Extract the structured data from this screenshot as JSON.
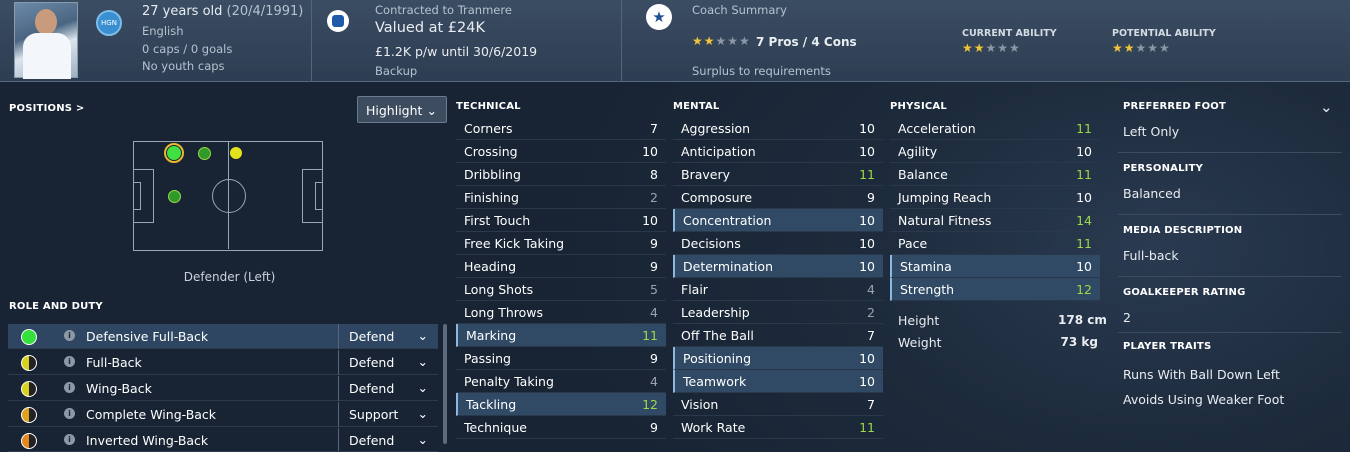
{
  "header": {
    "age": "27 years old",
    "dob": "(20/4/1991)",
    "nation_badge": "HGN",
    "nationality": "English",
    "caps": "0 caps / 0 goals",
    "youth_caps": "No youth caps",
    "contract_label": "Contracted to Tranmere",
    "value": "Valued at £24K",
    "wage": "£1.2K p/w until 30/6/2019",
    "squad_status": "Backup",
    "coach_label": "Coach Summary",
    "coach_rating": 2,
    "pros_cons": "7 Pros / 4 Cons",
    "coach_verdict": "Surplus to requirements",
    "current_ability_label": "CURRENT ABILITY",
    "current_ability": 2,
    "potential_ability_label": "POTENTIAL ABILITY",
    "potential_ability": 2
  },
  "positions": {
    "label": "POSITIONS >",
    "highlight": "Highlight",
    "position_text": "Defender (Left)"
  },
  "roles": {
    "label": "ROLE AND DUTY",
    "items": [
      {
        "name": "Defensive Full-Back",
        "duty": "Defend",
        "color": "#35e03c"
      },
      {
        "name": "Full-Back",
        "duty": "Defend",
        "color": "#d8d21e"
      },
      {
        "name": "Wing-Back",
        "duty": "Defend",
        "color": "#d8d21e"
      },
      {
        "name": "Complete Wing-Back",
        "duty": "Support",
        "color": "#e0a020"
      },
      {
        "name": "Inverted Wing-Back",
        "duty": "Defend",
        "color": "#e08a20"
      }
    ]
  },
  "technical": {
    "label": "TECHNICAL",
    "items": [
      {
        "name": "Corners",
        "value": "7"
      },
      {
        "name": "Crossing",
        "value": "10"
      },
      {
        "name": "Dribbling",
        "value": "8"
      },
      {
        "name": "Finishing",
        "value": "2"
      },
      {
        "name": "First Touch",
        "value": "10"
      },
      {
        "name": "Free Kick Taking",
        "value": "9"
      },
      {
        "name": "Heading",
        "value": "9"
      },
      {
        "name": "Long Shots",
        "value": "5"
      },
      {
        "name": "Long Throws",
        "value": "4"
      },
      {
        "name": "Marking",
        "value": "11"
      },
      {
        "name": "Passing",
        "value": "9"
      },
      {
        "name": "Penalty Taking",
        "value": "4"
      },
      {
        "name": "Tackling",
        "value": "12"
      },
      {
        "name": "Technique",
        "value": "9"
      }
    ]
  },
  "mental": {
    "label": "MENTAL",
    "items": [
      {
        "name": "Aggression",
        "value": "10"
      },
      {
        "name": "Anticipation",
        "value": "10"
      },
      {
        "name": "Bravery",
        "value": "11"
      },
      {
        "name": "Composure",
        "value": "9"
      },
      {
        "name": "Concentration",
        "value": "10"
      },
      {
        "name": "Decisions",
        "value": "10"
      },
      {
        "name": "Determination",
        "value": "10"
      },
      {
        "name": "Flair",
        "value": "4"
      },
      {
        "name": "Leadership",
        "value": "2"
      },
      {
        "name": "Off The Ball",
        "value": "7"
      },
      {
        "name": "Positioning",
        "value": "10"
      },
      {
        "name": "Teamwork",
        "value": "10"
      },
      {
        "name": "Vision",
        "value": "7"
      },
      {
        "name": "Work Rate",
        "value": "11"
      }
    ]
  },
  "physical": {
    "label": "PHYSICAL",
    "items": [
      {
        "name": "Acceleration",
        "value": "11"
      },
      {
        "name": "Agility",
        "value": "10"
      },
      {
        "name": "Balance",
        "value": "11"
      },
      {
        "name": "Jumping Reach",
        "value": "10"
      },
      {
        "name": "Natural Fitness",
        "value": "14"
      },
      {
        "name": "Pace",
        "value": "11"
      },
      {
        "name": "Stamina",
        "value": "10"
      },
      {
        "name": "Strength",
        "value": "12"
      }
    ],
    "height_label": "Height",
    "height": "178 cm",
    "weight_label": "Weight",
    "weight": "73 kg"
  },
  "info": {
    "foot_label": "PREFERRED FOOT",
    "foot": "Left Only",
    "personality_label": "PERSONALITY",
    "personality": "Balanced",
    "media_label": "MEDIA DESCRIPTION",
    "media": "Full-back",
    "gk_label": "GOALKEEPER RATING",
    "gk": "2",
    "traits_label": "PLAYER TRAITS",
    "traits": [
      "Runs With Ball Down Left",
      "Avoids Using Weaker Foot"
    ]
  }
}
